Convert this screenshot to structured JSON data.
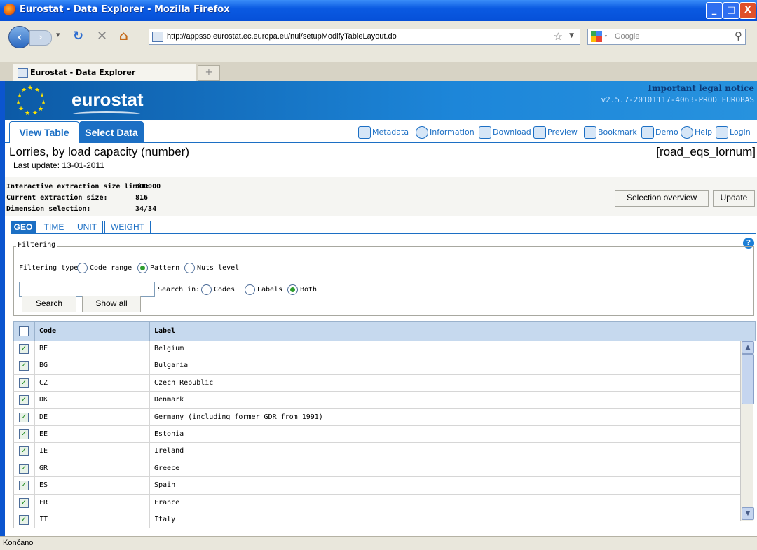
{
  "window": {
    "title": "Eurostat - Data Explorer - Mozilla Firefox",
    "controls": [
      "_",
      "□",
      "X"
    ]
  },
  "browser": {
    "url": "http://appsso.eurostat.ec.europa.eu/nui/setupModifyTableLayout.do",
    "search_placeholder": "Google",
    "tab_label": "Eurostat - Data Explorer",
    "new_tab": "+",
    "status": "Končano"
  },
  "site": {
    "logo": "eurostat",
    "legal_notice": "Important legal notice",
    "version": "v2.5.7-20101117-4063-PROD_EUROBAS",
    "tabs": {
      "view_table": "View Table",
      "select_data": "Select Data"
    },
    "tools": [
      "Metadata",
      "Information",
      "Download",
      "Preview",
      "Bookmark",
      "Demo",
      "Help",
      "Login"
    ]
  },
  "dataset": {
    "title": "Lorries, by load capacity (number)",
    "code": "[road_eqs_lornum]",
    "last_update": "Last update: 13-01-2011"
  },
  "extraction": {
    "limit_label": "Interactive extraction size limit:",
    "limit_value": "300000",
    "current_label": "Current extraction size:",
    "current_value": "816",
    "dimension_label": "Dimension selection:",
    "dimension_value": "34/34",
    "selection_overview": "Selection overview",
    "update": "Update"
  },
  "dimension_tabs": [
    "GEO",
    "TIME",
    "UNIT",
    "WEIGHT"
  ],
  "filtering": {
    "legend": "Filtering",
    "type_label": "Filtering type:",
    "types": [
      "Code range",
      "Pattern",
      "Nuts level"
    ],
    "selected_type": "Pattern",
    "search_value": "",
    "search_in_label": "Search in:",
    "search_in": [
      "Codes",
      "Labels",
      "Both"
    ],
    "selected_search_in": "Both",
    "search_button": "Search",
    "show_all_button": "Show all"
  },
  "grid": {
    "columns": [
      "Code",
      "Label"
    ],
    "rows": [
      {
        "code": "BE",
        "label": "Belgium",
        "checked": true
      },
      {
        "code": "BG",
        "label": "Bulgaria",
        "checked": true
      },
      {
        "code": "CZ",
        "label": "Czech Republic",
        "checked": true
      },
      {
        "code": "DK",
        "label": "Denmark",
        "checked": true
      },
      {
        "code": "DE",
        "label": "Germany (including former GDR from 1991)",
        "checked": true
      },
      {
        "code": "EE",
        "label": "Estonia",
        "checked": true
      },
      {
        "code": "IE",
        "label": "Ireland",
        "checked": true
      },
      {
        "code": "GR",
        "label": "Greece",
        "checked": true
      },
      {
        "code": "ES",
        "label": "Spain",
        "checked": true
      },
      {
        "code": "FR",
        "label": "France",
        "checked": true
      },
      {
        "code": "IT",
        "label": "Italy",
        "checked": true
      }
    ]
  },
  "colors": {
    "accent": "#1c6fc4",
    "banner": "#1d86d9",
    "titlebar": "#0a5ae2"
  }
}
